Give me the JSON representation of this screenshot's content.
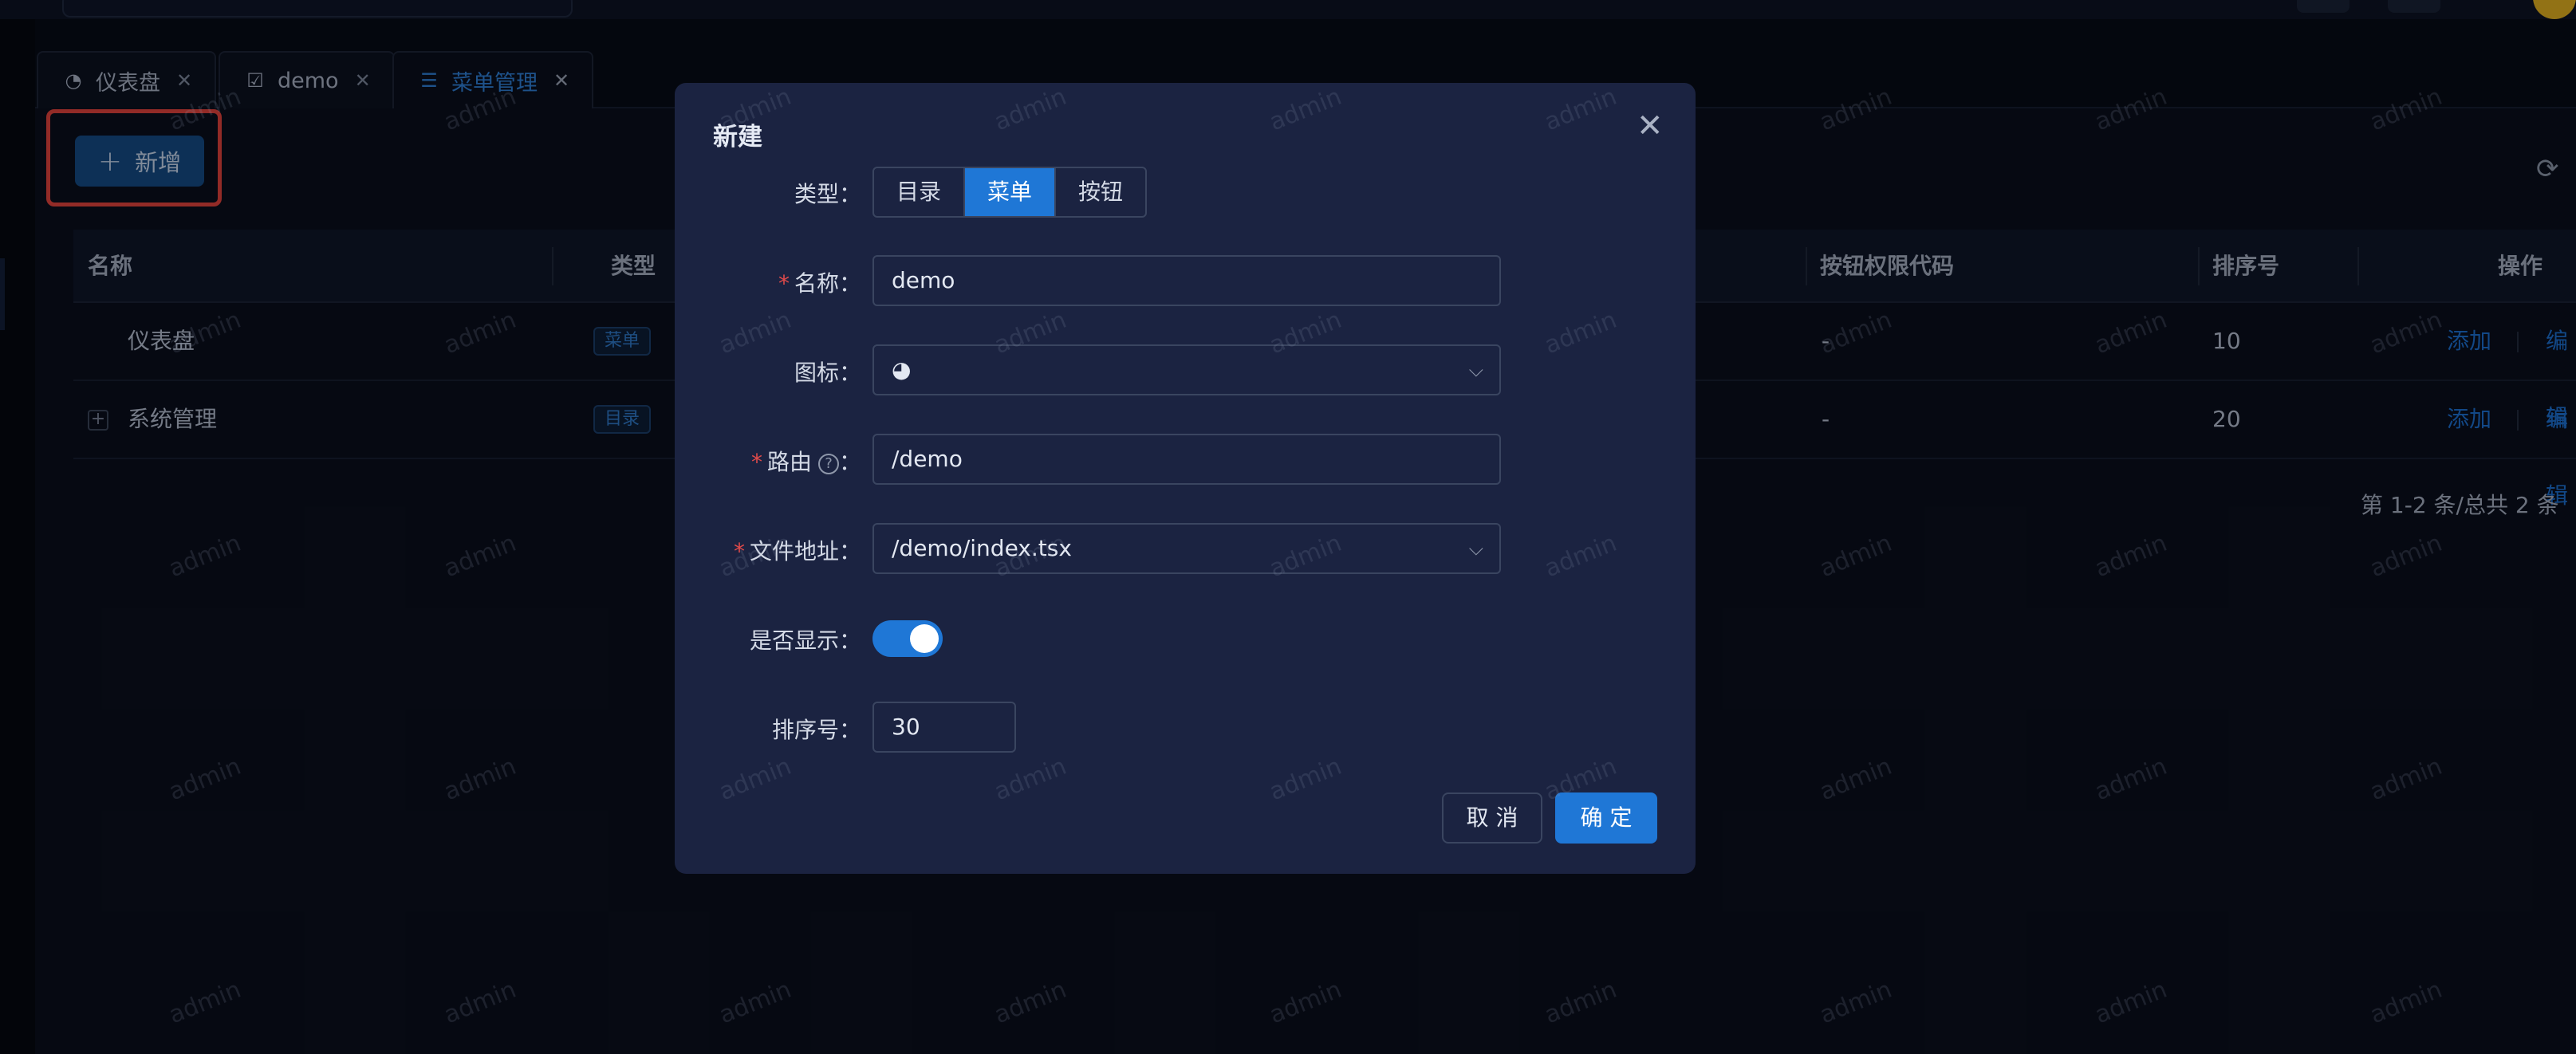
{
  "tabs": [
    {
      "label": "仪表盘",
      "icon": "dashboard-icon"
    },
    {
      "label": "demo",
      "icon": "checkbox-icon"
    },
    {
      "label": "菜单管理",
      "icon": "menu-list-icon"
    }
  ],
  "toolbar": {
    "add_label": "新增"
  },
  "table": {
    "columns": [
      "名称",
      "类型",
      "按钮权限代码",
      "排序号",
      "操作"
    ],
    "rows": [
      {
        "name": "仪表盘",
        "type": "菜单",
        "perm": "-",
        "order": "10",
        "action_add": "添加",
        "action_edit": "编辑"
      },
      {
        "name": "系统管理",
        "type": "目录",
        "perm": "-",
        "order": "20",
        "action_add": "添加",
        "action_edit": "编辑"
      }
    ],
    "pagination": "第 1-2 条/总共 2 条"
  },
  "watermark": "admin",
  "modal": {
    "title": "新建",
    "fields": {
      "type": {
        "label": "类型",
        "options": [
          "目录",
          "菜单",
          "按钮"
        ],
        "selected": "菜单"
      },
      "name": {
        "label": "名称",
        "value": "demo"
      },
      "icon": {
        "label": "图标",
        "value": "pie-chart-icon"
      },
      "route": {
        "label": "路由",
        "value": "/demo"
      },
      "file": {
        "label": "文件地址",
        "value": "/demo/index.tsx"
      },
      "show": {
        "label": "是否显示",
        "value": true
      },
      "order": {
        "label": "排序号",
        "value": "30"
      }
    },
    "cancel_label": "取 消",
    "ok_label": "确 定"
  },
  "colors": {
    "accent": "#1f77d6",
    "highlight": "#e0423c",
    "background": "#070b16",
    "modal": "#1b2341"
  }
}
